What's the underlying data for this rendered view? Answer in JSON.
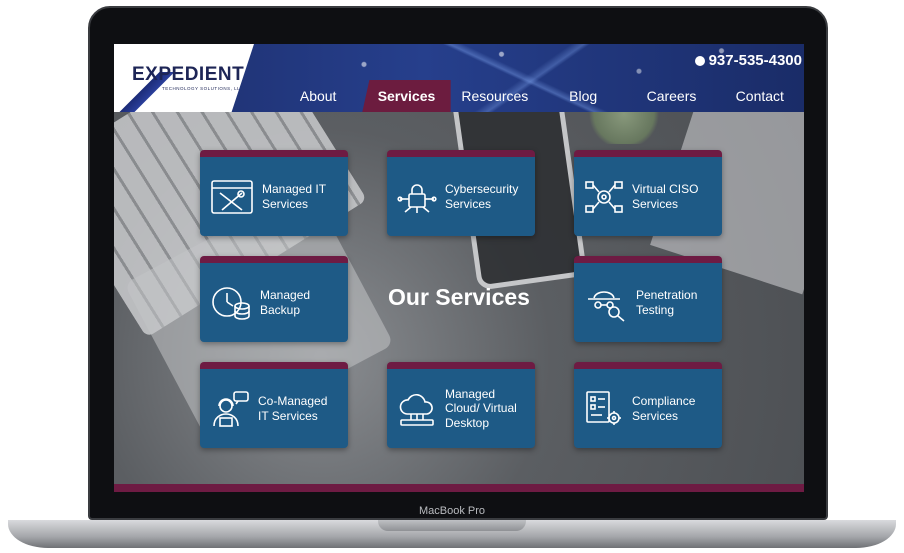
{
  "device": {
    "model_label": "MacBook Pro"
  },
  "brand": {
    "logo_text": "EXPEDIENT",
    "logo_subtext": "TECHNOLOGY SOLUTIONS, LLC"
  },
  "header": {
    "phone": "937-535-4300"
  },
  "nav": {
    "items": [
      {
        "label": "About"
      },
      {
        "label": "Services",
        "active": true
      },
      {
        "label": "Resources"
      },
      {
        "label": "Blog"
      },
      {
        "label": "Careers"
      },
      {
        "label": "Contact"
      }
    ]
  },
  "main": {
    "title": "Our Services",
    "services": [
      {
        "label": "Managed IT Services",
        "icon": "tools-icon"
      },
      {
        "label": "Cybersecurity Services",
        "icon": "lock-circuit-icon"
      },
      {
        "label": "Virtual CISO Services",
        "icon": "gear-network-icon"
      },
      {
        "label": "Managed Backup",
        "icon": "clock-database-icon"
      },
      {
        "label": "Penetration Testing",
        "icon": "spy-magnifier-icon"
      },
      {
        "label": "Co-Managed IT Services",
        "icon": "support-agent-icon"
      },
      {
        "label": "Managed Cloud/ Virtual Desktop",
        "icon": "cloud-icon"
      },
      {
        "label": "Compliance Services",
        "icon": "checklist-gear-icon"
      }
    ]
  },
  "colors": {
    "header_blue": "#1d2e6c",
    "accent_maroon": "#6e1b43",
    "card_blue": "#1e5a86"
  }
}
